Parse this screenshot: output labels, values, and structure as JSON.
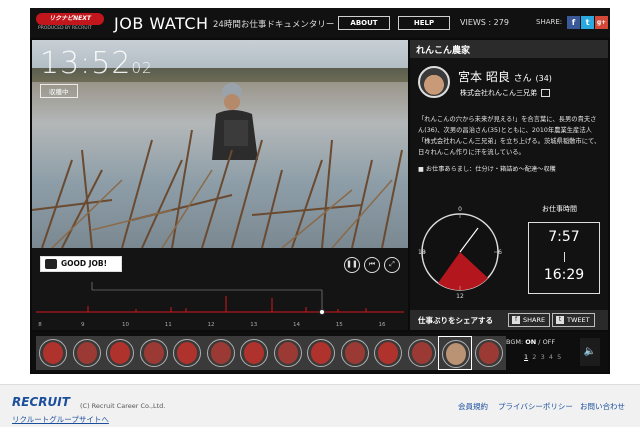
{
  "header": {
    "brand_logo": "リクナビNEXT",
    "brand_sub": "PRODUCED BY RECRUIT",
    "title": "JOB WATCH",
    "tagline": "24時間お仕事ドキュメンタリー",
    "about_label": "ABOUT",
    "help_label": "HELP",
    "views_label": "VIEWS : 279",
    "share_label": "SHARE:",
    "social": [
      {
        "icon": "facebook-icon",
        "glyph": "f",
        "color": "#3b5998"
      },
      {
        "icon": "twitter-icon",
        "glyph": "t",
        "color": "#2aa9e0"
      },
      {
        "icon": "google-plus-icon",
        "glyph": "g+",
        "color": "#d34836"
      }
    ]
  },
  "video": {
    "time_main": "13:52",
    "time_sec": "02",
    "stage": "収穫中"
  },
  "controls": {
    "good_job_label": "GOOD JOB!",
    "timeline_ticks": [
      "8",
      "9",
      "10",
      "11",
      "12",
      "13",
      "14",
      "15",
      "16"
    ],
    "accent_color": "#d0191f"
  },
  "profile": {
    "job_title": "れんこん農家",
    "name": "宮本 昭良",
    "honorific": "さん",
    "age": "(34)",
    "company": "株式会社れんこん三兄弟",
    "description": "「れんこんの穴から未来が見える!」を合言葉に、長男の貴夫さん(36)、次男の昌治さん(35)とともに、2010年農業生産法人「株式会社れんこん三兄弟」を立ち上げる。茨城県稲敷市にて、日々れんこん作りに汗を流している。",
    "steps": "■ お仕事あらまし：仕分け・箱詰め～配達～収穫",
    "clock_labels": {
      "top": "0",
      "right": "6",
      "bottom": "12",
      "left": "18"
    },
    "worktime_label": "お仕事時間",
    "start_time": "7:57",
    "end_time": "16:29",
    "share_label": "仕事ぶりをシェアする",
    "fb_share": "SHARE",
    "tweet": "TWEET"
  },
  "thumbs_bar": {
    "bgm_label": "BGM:",
    "bgm_on": "ON",
    "bgm_sep": " / ",
    "bgm_off": "OFF",
    "pages": [
      "1",
      "2",
      "3",
      "4",
      "5"
    ]
  },
  "footer": {
    "logo": "RECRUIT",
    "copyright": "(C) Recruit Career Co.,Ltd.",
    "group_link": "リクルートグループサイトへ",
    "links": [
      "会員規約",
      "プライバシーポリシー",
      "お問い合わせ"
    ]
  }
}
